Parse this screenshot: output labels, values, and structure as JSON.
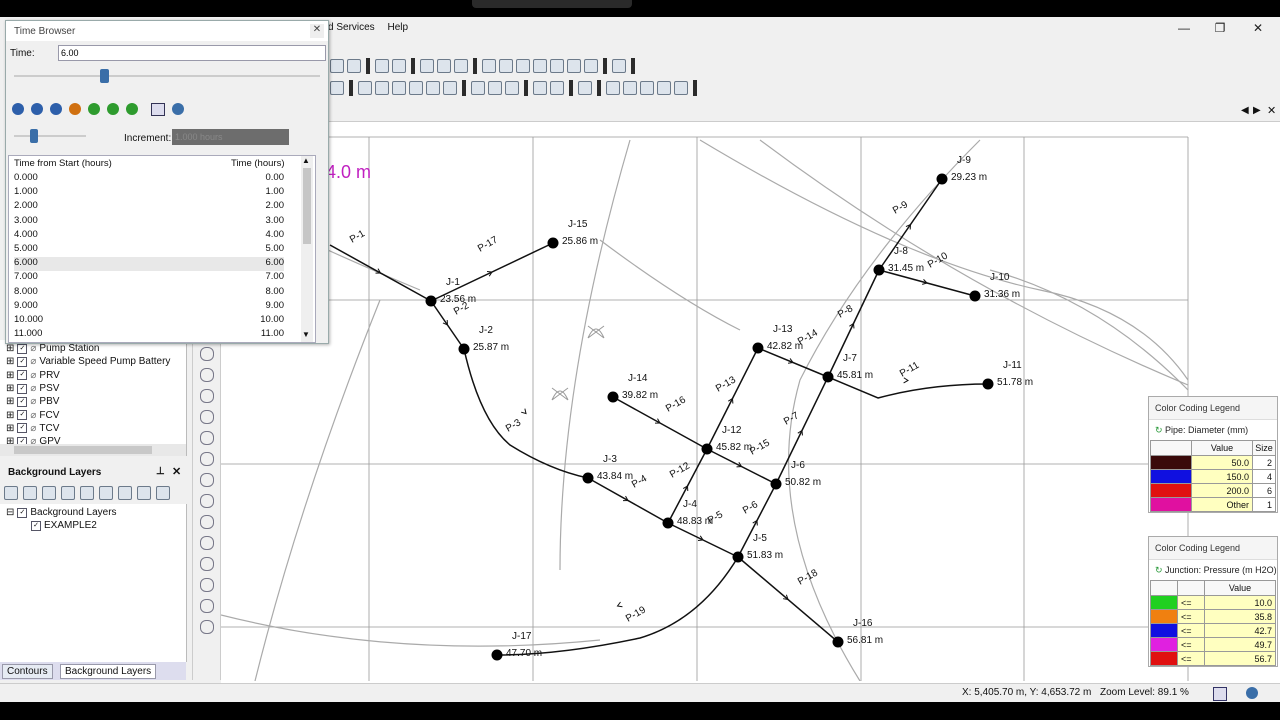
{
  "window": {
    "minimize": "—",
    "restore": "❐",
    "close": "✕"
  },
  "menu": {
    "items": [
      "d Services",
      "Help"
    ]
  },
  "time_browser": {
    "title": "Time Browser",
    "time_label": "Time:",
    "time_value": "6.00",
    "increment_label": "Increment:",
    "increment_value": "1.000 hours",
    "col_start": "Time from Start (hours)",
    "col_time": "Time (hours)",
    "slider_position": 0.28,
    "rows": [
      [
        "0.000",
        "0.00"
      ],
      [
        "1.000",
        "1.00"
      ],
      [
        "2.000",
        "2.00"
      ],
      [
        "3.000",
        "3.00"
      ],
      [
        "4.000",
        "4.00"
      ],
      [
        "5.000",
        "5.00"
      ],
      [
        "6.000",
        "6.00"
      ],
      [
        "7.000",
        "7.00"
      ],
      [
        "8.000",
        "8.00"
      ],
      [
        "9.000",
        "9.00"
      ],
      [
        "10.000",
        "10.00"
      ],
      [
        "11.000",
        "11.00"
      ]
    ],
    "selected_row": 6
  },
  "element_tree": {
    "items": [
      "Pump Station",
      "Variable Speed Pump Battery",
      "PRV",
      "PSV",
      "PBV",
      "FCV",
      "TCV",
      "GPV"
    ]
  },
  "background_layers": {
    "title": "Background Layers",
    "tree": [
      "Background Layers",
      "EXAMPLE2"
    ],
    "tabs": [
      "Contours",
      "Background Layers"
    ]
  },
  "map": {
    "annotation": "4.0 m",
    "junctions": [
      {
        "id": "J-9",
        "label": "29.23 m"
      },
      {
        "id": "J-15",
        "label": "25.86 m"
      },
      {
        "id": "J-8",
        "label": "31.45 m"
      },
      {
        "id": "J-10",
        "label": "31.36 m"
      },
      {
        "id": "J-1",
        "label": "23.56 m"
      },
      {
        "id": "J-2",
        "label": "25.87 m"
      },
      {
        "id": "J-13",
        "label": "42.82 m"
      },
      {
        "id": "J-7",
        "label": "45.81 m"
      },
      {
        "id": "J-11",
        "label": "51.78 m"
      },
      {
        "id": "J-14",
        "label": "39.82 m"
      },
      {
        "id": "J-12",
        "label": "45.82 m"
      },
      {
        "id": "J-6",
        "label": "50.82 m"
      },
      {
        "id": "J-3",
        "label": "43.84 m"
      },
      {
        "id": "J-4",
        "label": "48.83 m"
      },
      {
        "id": "J-5",
        "label": "51.83 m"
      },
      {
        "id": "J-16",
        "label": "56.81 m"
      },
      {
        "id": "J-17",
        "label": "47.70 m"
      }
    ],
    "pipes": [
      "P-1",
      "P-17",
      "P-9",
      "P-10",
      "P-8",
      "P-2",
      "P-14",
      "P-11",
      "P-13",
      "P-16",
      "P-7",
      "P-15",
      "P-3",
      "P-12",
      "P-4",
      "P-5",
      "P-6",
      "P-18",
      "P-19"
    ]
  },
  "legend_pipe": {
    "title": "Color Coding Legend",
    "subtitle": "Pipe: Diameter (mm)",
    "columns": [
      "Value",
      "Size"
    ],
    "rows": [
      {
        "color": "#3a0a0a",
        "op": "<=",
        "value": "50.0",
        "size": "2"
      },
      {
        "color": "#1010e0",
        "op": "<=",
        "value": "150.0",
        "size": "4"
      },
      {
        "color": "#e01010",
        "op": "<=",
        "value": "200.0",
        "size": "6"
      },
      {
        "color": "#e010a0",
        "op": "",
        "value": "Other",
        "size": "1"
      }
    ]
  },
  "legend_junction": {
    "title": "Color Coding Legend",
    "subtitle": "Junction: Pressure (m H2O)",
    "columns": [
      "Value"
    ],
    "rows": [
      {
        "color": "#20d020",
        "op": "<=",
        "value": "10.0"
      },
      {
        "color": "#f08010",
        "op": "<=",
        "value": "35.8"
      },
      {
        "color": "#1010e0",
        "op": "<=",
        "value": "42.7"
      },
      {
        "color": "#e020e0",
        "op": "<=",
        "value": "49.7"
      },
      {
        "color": "#e01010",
        "op": "<=",
        "value": "56.7"
      }
    ]
  },
  "status": {
    "coords": "X: 5,405.70 m, Y: 4,653.72 m",
    "zoom": "Zoom Level: 89.1 %"
  }
}
